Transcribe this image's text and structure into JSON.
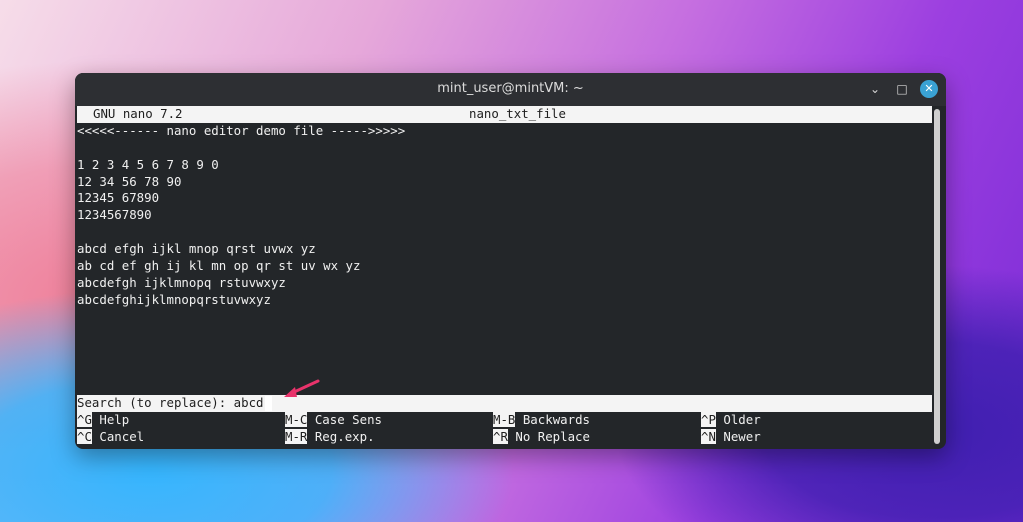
{
  "window": {
    "title": "mint_user@mintVM: ~"
  },
  "header": {
    "left": "GNU nano 7.2",
    "center": "nano_txt_file"
  },
  "editor_lines": [
    "<<<<<------ nano editor demo file ----->>>>>",
    "",
    "1 2 3 4 5 6 7 8 9 0",
    "12 34 56 78 90",
    "12345 67890",
    "1234567890",
    "",
    "abcd efgh ijkl mnop qrst uvwx yz",
    "ab cd ef gh ij kl mn op qr st uv wx yz",
    "abcdefgh ijklmnopq rstuvwxyz",
    "abcdefghijklmnopqrstuvwxyz"
  ],
  "search": {
    "prompt": "Search (to replace): ",
    "value": "abcd"
  },
  "shortcuts": {
    "row1": [
      {
        "key": "^G",
        "label": " Help"
      },
      {
        "key": "M-C",
        "label": " Case Sens"
      },
      {
        "key": "M-B",
        "label": " Backwards"
      },
      {
        "key": "^P",
        "label": " Older"
      }
    ],
    "row2": [
      {
        "key": "^C",
        "label": " Cancel"
      },
      {
        "key": "M-R",
        "label": " Reg.exp."
      },
      {
        "key": "^R",
        "label": " No Replace"
      },
      {
        "key": "^N",
        "label": " Newer"
      }
    ]
  },
  "annotation": {
    "arrow_color": "#e8336b"
  }
}
